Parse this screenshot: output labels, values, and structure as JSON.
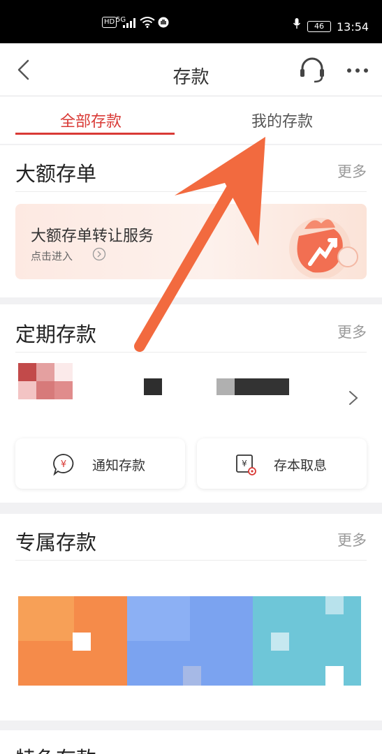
{
  "status_bar": {
    "hd": "HD",
    "network": "5G",
    "battery": "46",
    "time": "13:54"
  },
  "header": {
    "title": "存款",
    "back_icon": "back-chevron-icon",
    "support_icon": "headset-icon",
    "more_icon": "more-icon"
  },
  "tabs": [
    {
      "label": "全部存款",
      "active": true
    },
    {
      "label": "我的存款",
      "active": false
    }
  ],
  "sections": {
    "large_cd": {
      "title": "大额存单",
      "more": "更多",
      "banner": {
        "title": "大额存单转让服务",
        "subtitle": "点击进入"
      }
    },
    "fixed": {
      "title": "定期存款",
      "more": "更多",
      "actions": [
        {
          "label": "通知存款",
          "icon": "yen-chat-icon"
        },
        {
          "label": "存本取息",
          "icon": "yen-deposit-icon"
        }
      ]
    },
    "exclusive": {
      "title": "专属存款",
      "more": "更多"
    },
    "special": {
      "title": "特色存款"
    }
  },
  "colors": {
    "accent": "#d93a36",
    "arrow": "#f26a3f",
    "muted": "#999999"
  }
}
